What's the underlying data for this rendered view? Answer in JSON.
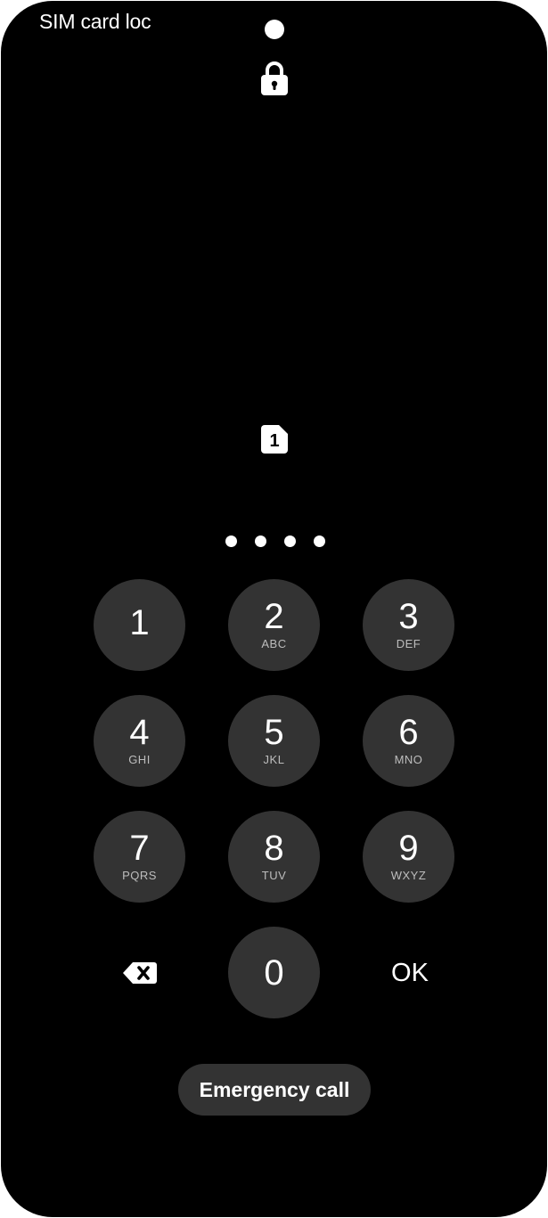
{
  "status_bar": {
    "title": "SIM card loc"
  },
  "sim": {
    "slot": "1"
  },
  "pin": {
    "entered_count": 4
  },
  "keypad": {
    "keys": [
      {
        "digit": "1",
        "letters": ""
      },
      {
        "digit": "2",
        "letters": "ABC"
      },
      {
        "digit": "3",
        "letters": "DEF"
      },
      {
        "digit": "4",
        "letters": "GHI"
      },
      {
        "digit": "5",
        "letters": "JKL"
      },
      {
        "digit": "6",
        "letters": "MNO"
      },
      {
        "digit": "7",
        "letters": "PQRS"
      },
      {
        "digit": "8",
        "letters": "TUV"
      },
      {
        "digit": "9",
        "letters": "WXYZ"
      },
      {
        "digit": "0",
        "letters": ""
      }
    ],
    "ok_label": "OK",
    "backspace_icon": "backspace-icon"
  },
  "emergency_call": {
    "label": "Emergency call"
  },
  "colors": {
    "background": "#000000",
    "key_fill": "#333333",
    "text": "#ffffff",
    "subtext": "#bdbdbd"
  },
  "icons": {
    "lock": "lock-icon",
    "sim": "sim-card-icon",
    "camera": "front-camera"
  }
}
